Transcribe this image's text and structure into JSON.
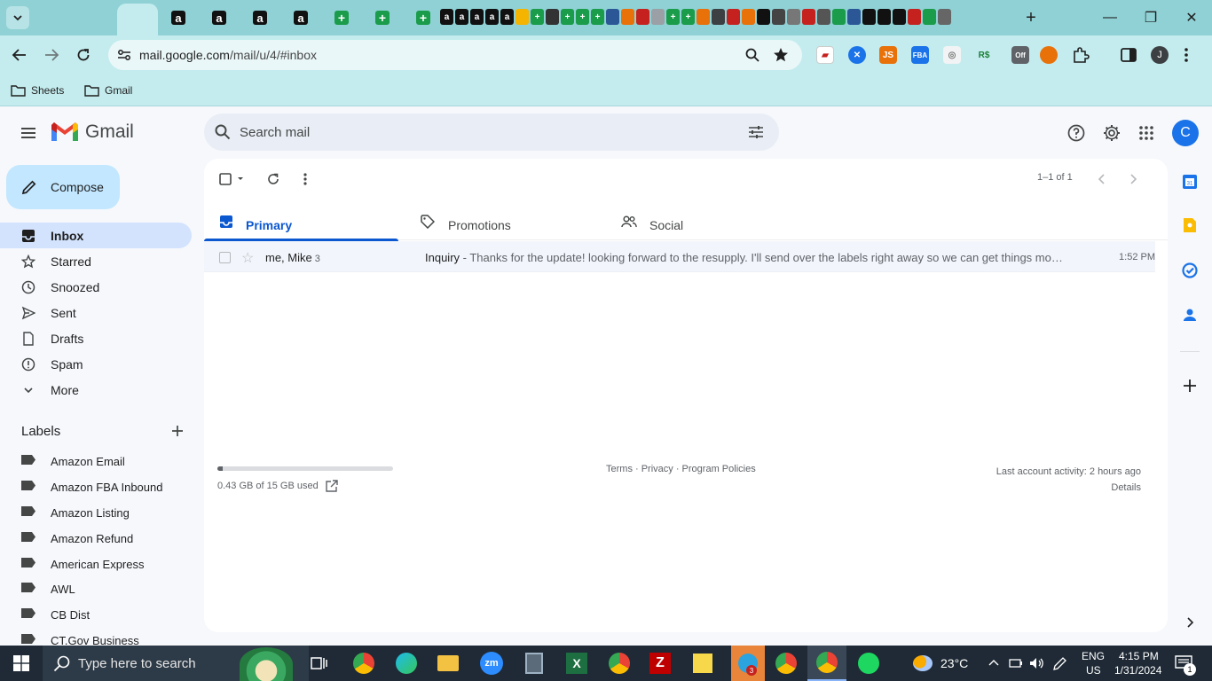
{
  "browser": {
    "url_host": "mail.google.com",
    "url_path": "/mail/u/4/#inbox",
    "bookmarks": [
      "Sheets",
      "Gmail"
    ],
    "tiny_tab_letters": [
      "a",
      "a",
      "a",
      "a",
      "a"
    ],
    "ext_labels": [
      "JS",
      "FBA",
      "R$"
    ],
    "profile_initial": "J"
  },
  "gmail": {
    "app_name": "Gmail",
    "search_placeholder": "Search mail",
    "avatar_initial": "C",
    "compose_label": "Compose",
    "nav": [
      {
        "label": "Inbox",
        "icon": "inbox-icon",
        "active": true
      },
      {
        "label": "Starred",
        "icon": "star-icon"
      },
      {
        "label": "Snoozed",
        "icon": "clock-icon"
      },
      {
        "label": "Sent",
        "icon": "send-icon"
      },
      {
        "label": "Drafts",
        "icon": "draft-icon"
      },
      {
        "label": "Spam",
        "icon": "spam-icon"
      },
      {
        "label": "More",
        "icon": "chevron-down-icon"
      }
    ],
    "labels_title": "Labels",
    "labels": [
      "Amazon Email",
      "Amazon FBA Inbound",
      "Amazon Listing",
      "Amazon Refund",
      "American Express",
      "AWL",
      "CB Dist",
      "CT.Gov Business"
    ],
    "pager": "1–1 of 1",
    "tabs": [
      "Primary",
      "Promotions",
      "Social"
    ],
    "email": {
      "sender": "me, Mike",
      "count": "3",
      "subject": "Inquiry",
      "snippet": " - Thanks for the update! looking forward to the resupply. I'll send over the labels right away so we can get things movi...",
      "time": "1:52 PM"
    },
    "storage": {
      "text": "0.43 GB of 15 GB used",
      "used_fraction": 0.029
    },
    "footer_links": "Terms · Privacy · Program Policies",
    "activity": "Last account activity: 2 hours ago",
    "details": "Details"
  },
  "taskbar": {
    "search_placeholder": "Type here to search",
    "weather": "23°C",
    "lang": "ENG",
    "region": "US",
    "time": "4:15 PM",
    "date": "1/31/2024",
    "notification_count": "1",
    "telegram_badge": "3"
  },
  "colors": {
    "tabstrip": "#8fd1d5",
    "toolbar": "#c4ecee",
    "accent": "#0b57d0",
    "compose": "#c2e7ff",
    "nav_active": "#d3e3fd"
  }
}
